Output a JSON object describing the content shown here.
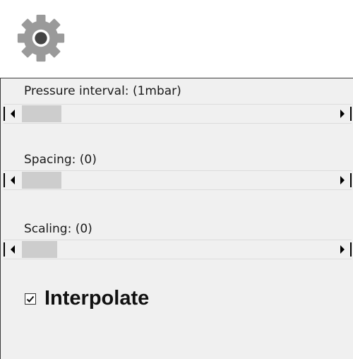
{
  "header": {
    "icon": "gear-icon"
  },
  "sliders": [
    {
      "label": "Pressure interval: (1mbar)",
      "position": 0.0
    },
    {
      "label": "Spacing: (0)",
      "position": 0.0
    },
    {
      "label": "Scaling: (0)",
      "position": 0.0
    }
  ],
  "interpolate": {
    "label": "Interpolate",
    "checked": true
  },
  "colors": {
    "gear": "#9a9a9a",
    "gear_hole": "#444444",
    "panel": "#f0f0f0",
    "thumb": "#cdcdcd"
  }
}
